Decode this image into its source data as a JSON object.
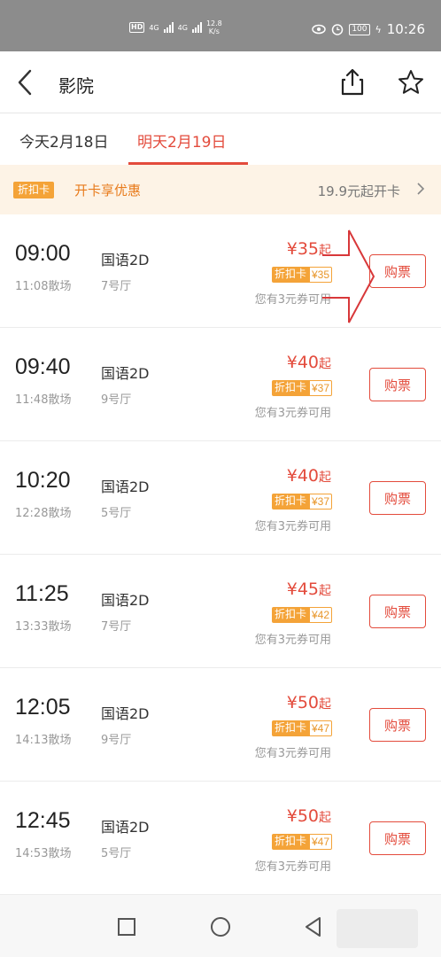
{
  "status_bar": {
    "hd_label": "HD",
    "signal1": "4G",
    "signal2": "4G",
    "net_speed": "12.8",
    "net_unit": "K/s",
    "battery": "100",
    "time": "10:26"
  },
  "header": {
    "title": "影院"
  },
  "date_tabs": [
    {
      "label": "今天2月18日",
      "active": false
    },
    {
      "label": "明天2月19日",
      "active": true
    }
  ],
  "promo": {
    "badge": "折扣卡",
    "text": "开卡享优惠",
    "price": "19.9元起开卡"
  },
  "showtimes": [
    {
      "start": "09:00",
      "end": "11:08散场",
      "language": "国语2D",
      "hall": "7号厅",
      "price": "¥35",
      "qi": "起",
      "card_label": "折扣卡",
      "card_price": "¥35",
      "coupon": "您有3元券可用",
      "buy": "购票"
    },
    {
      "start": "09:40",
      "end": "11:48散场",
      "language": "国语2D",
      "hall": "9号厅",
      "price": "¥40",
      "qi": "起",
      "card_label": "折扣卡",
      "card_price": "¥37",
      "coupon": "您有3元券可用",
      "buy": "购票"
    },
    {
      "start": "10:20",
      "end": "12:28散场",
      "language": "国语2D",
      "hall": "5号厅",
      "price": "¥40",
      "qi": "起",
      "card_label": "折扣卡",
      "card_price": "¥37",
      "coupon": "您有3元券可用",
      "buy": "购票"
    },
    {
      "start": "11:25",
      "end": "13:33散场",
      "language": "国语2D",
      "hall": "7号厅",
      "price": "¥45",
      "qi": "起",
      "card_label": "折扣卡",
      "card_price": "¥42",
      "coupon": "您有3元券可用",
      "buy": "购票"
    },
    {
      "start": "12:05",
      "end": "14:13散场",
      "language": "国语2D",
      "hall": "9号厅",
      "price": "¥50",
      "qi": "起",
      "card_label": "折扣卡",
      "card_price": "¥47",
      "coupon": "您有3元券可用",
      "buy": "购票"
    },
    {
      "start": "12:45",
      "end": "14:53散场",
      "language": "国语2D",
      "hall": "5号厅",
      "price": "¥50",
      "qi": "起",
      "card_label": "折扣卡",
      "card_price": "¥47",
      "coupon": "您有3元券可用",
      "buy": "购票"
    }
  ],
  "colors": {
    "accent": "#e34b3c",
    "card_orange": "#f4a338",
    "promo_bg": "#fdf3e6",
    "status_bar": "#8c8c8c"
  },
  "icons": {
    "back": "back-arrow-icon",
    "share": "share-icon",
    "favorite": "star-icon",
    "promo_more": "chevron-right-icon",
    "nav_recent": "square-icon",
    "nav_home": "circle-icon",
    "nav_back": "triangle-back-icon"
  }
}
